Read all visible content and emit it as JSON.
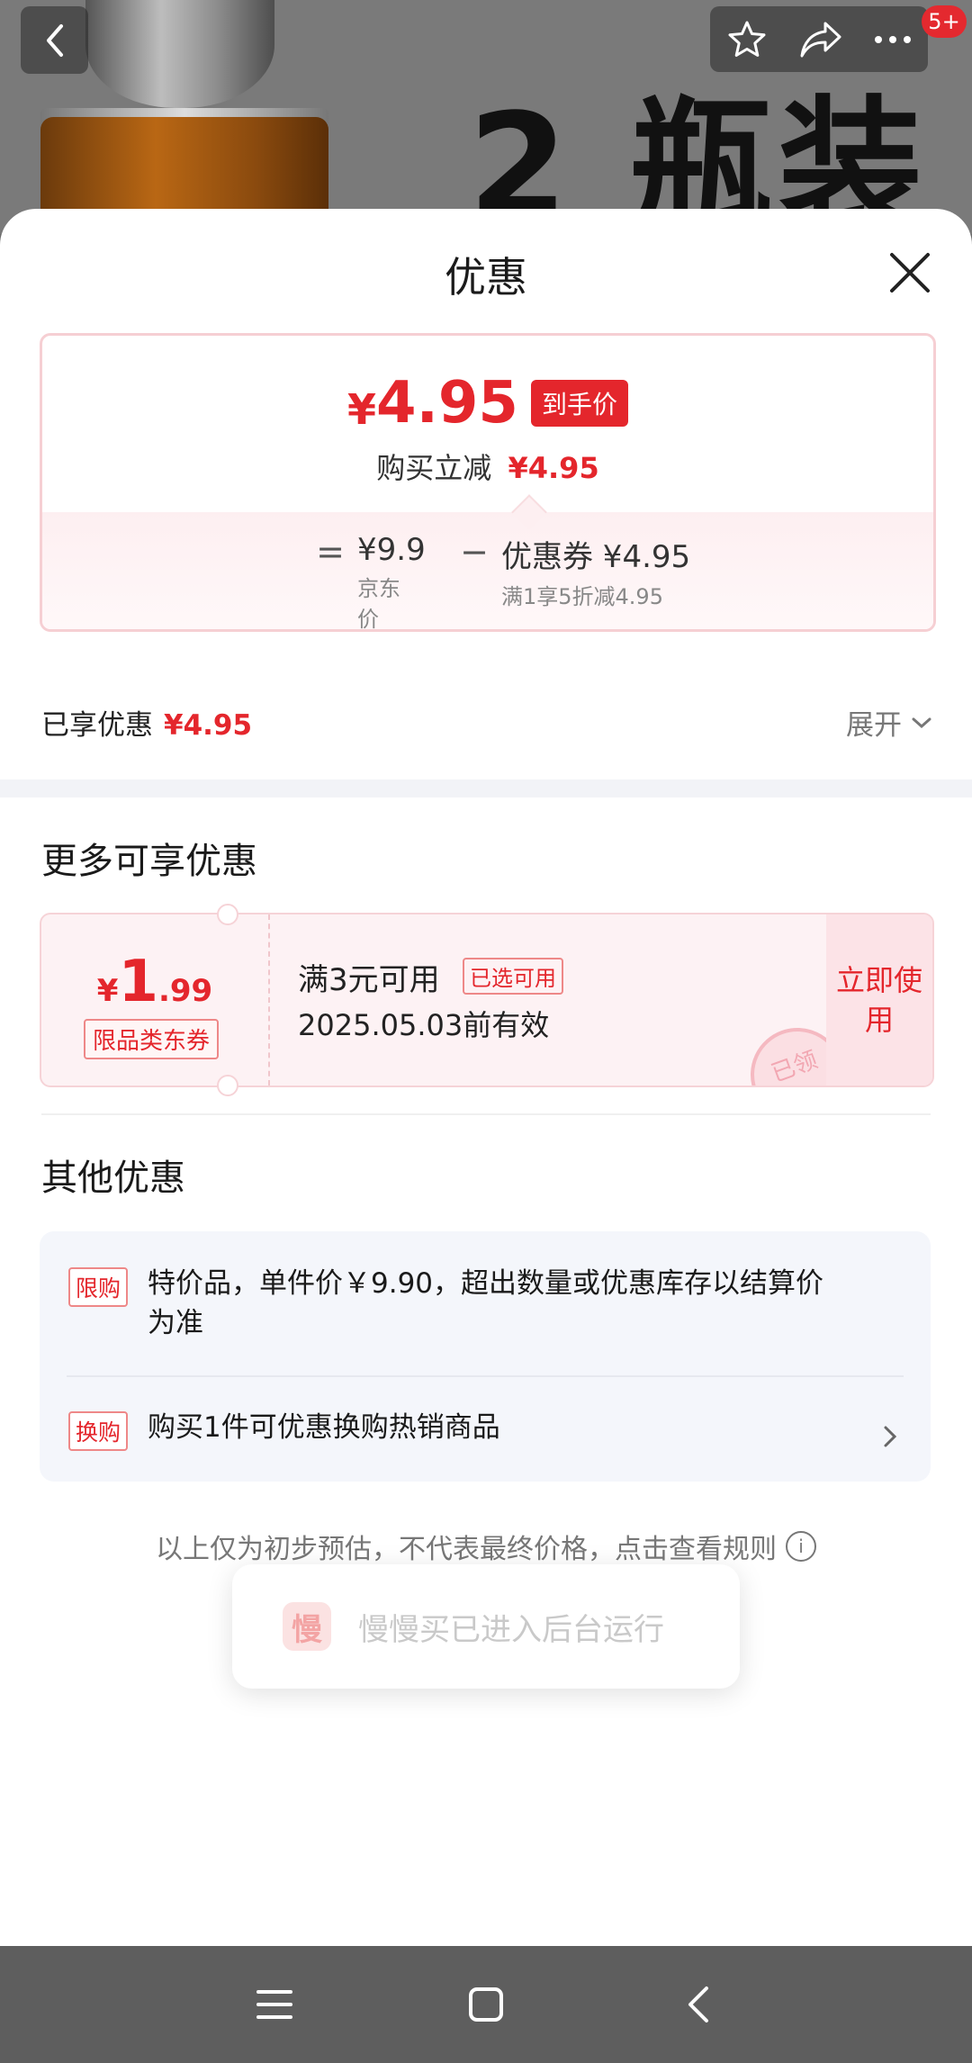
{
  "header": {
    "promo_text": "2 瓶装",
    "badge_count": "5+"
  },
  "icons": {
    "back": "chevron-left-icon",
    "favorite": "star-icon",
    "share": "share-icon",
    "more": "more-icon",
    "close": "close-icon",
    "expand": "chevron-down-icon",
    "arrow": "chevron-right-icon",
    "info": "info-icon"
  },
  "sheet": {
    "title": "优惠",
    "price": {
      "currency": "¥",
      "amount": "4.95",
      "tag": "到手价",
      "sub_label": "购买立减",
      "sub_value": "¥4.95",
      "formula": {
        "equals": "=",
        "minus": "−",
        "base_value": "¥9.9",
        "base_label": "京东价",
        "discount_value": "优惠券 ¥4.95",
        "discount_label": "满1享5折减4.95"
      }
    },
    "enjoyed": {
      "label": "已享优惠",
      "value": "¥4.95",
      "expand_label": "展开"
    },
    "more_title": "更多可享优惠",
    "coupon": {
      "currency": "¥",
      "amount_int": "1",
      "amount_dec": ".99",
      "type": "限品类东券",
      "condition": "满3元可用",
      "claimed_tag": "已选可用",
      "validity": "2025.05.03前有效",
      "use_button": "立即使用",
      "stamp": "已领"
    },
    "other_title": "其他优惠",
    "other_offers": [
      {
        "tag": "限购",
        "text": "特价品，单件价￥9.90，超出数量或优惠库存以结算价为准"
      },
      {
        "tag": "换购",
        "text": "购买1件可优惠换购热销商品"
      }
    ],
    "disclaimer": "以上仅为初步预估，不代表最终价格，点击查看规则",
    "info_glyph": "i"
  },
  "toast": {
    "logo": "慢",
    "text": "慢慢买已进入后台运行"
  },
  "colors": {
    "accent": "#e4262c",
    "nav_bg": "#5e5e5e",
    "card_border": "#f6cfd3"
  }
}
